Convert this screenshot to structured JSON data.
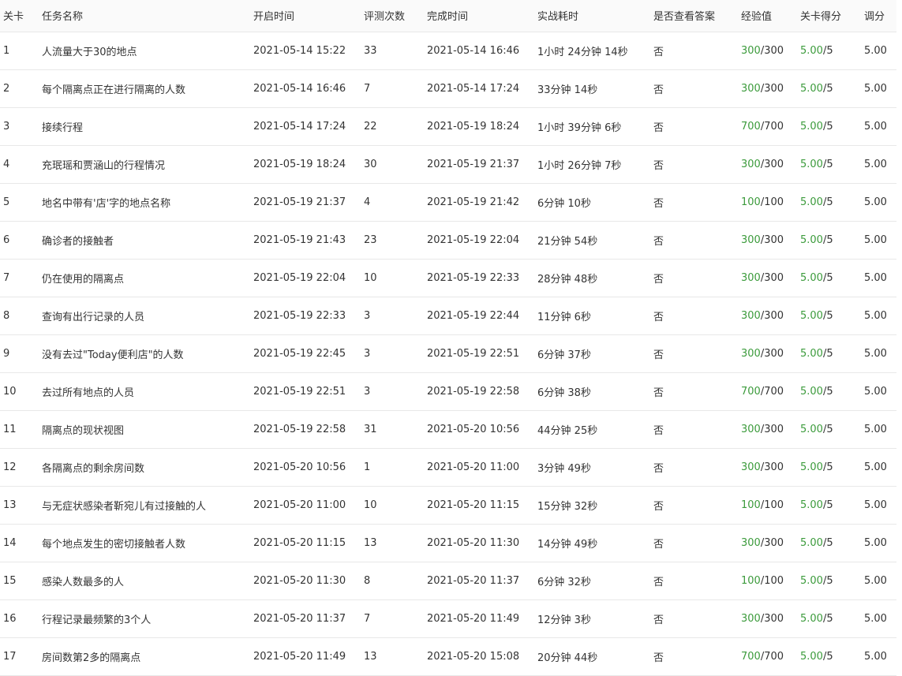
{
  "table": {
    "columns": [
      "关卡",
      "任务名称",
      "开启时间",
      "评测次数",
      "完成时间",
      "实战耗时",
      "是否查看答案",
      "经验值",
      "关卡得分",
      "调分"
    ],
    "rows": [
      {
        "level": "1",
        "name": "人流量大于30的地点",
        "start": "2021-05-14 15:22",
        "evals": "33",
        "finish": "2021-05-14 16:46",
        "duration": "1小时 24分钟 14秒",
        "answer_viewed": "否",
        "exp_value": "300",
        "exp_max": "/300",
        "score_value": "5.00",
        "score_max": "/5",
        "adjust": "5.00"
      },
      {
        "level": "2",
        "name": "每个隔离点正在进行隔离的人数",
        "start": "2021-05-14 16:46",
        "evals": "7",
        "finish": "2021-05-14 17:24",
        "duration": "33分钟 14秒",
        "answer_viewed": "否",
        "exp_value": "300",
        "exp_max": "/300",
        "score_value": "5.00",
        "score_max": "/5",
        "adjust": "5.00"
      },
      {
        "level": "3",
        "name": "接续行程",
        "start": "2021-05-14 17:24",
        "evals": "22",
        "finish": "2021-05-19 18:24",
        "duration": "1小时 39分钟 6秒",
        "answer_viewed": "否",
        "exp_value": "700",
        "exp_max": "/700",
        "score_value": "5.00",
        "score_max": "/5",
        "adjust": "5.00"
      },
      {
        "level": "4",
        "name": "充珉瑶和贾涵山的行程情况",
        "start": "2021-05-19 18:24",
        "evals": "30",
        "finish": "2021-05-19 21:37",
        "duration": "1小时 26分钟 7秒",
        "answer_viewed": "否",
        "exp_value": "300",
        "exp_max": "/300",
        "score_value": "5.00",
        "score_max": "/5",
        "adjust": "5.00"
      },
      {
        "level": "5",
        "name": "地名中带有'店'字的地点名称",
        "start": "2021-05-19 21:37",
        "evals": "4",
        "finish": "2021-05-19 21:42",
        "duration": "6分钟 10秒",
        "answer_viewed": "否",
        "exp_value": "100",
        "exp_max": "/100",
        "score_value": "5.00",
        "score_max": "/5",
        "adjust": "5.00"
      },
      {
        "level": "6",
        "name": "确诊者的接触者",
        "start": "2021-05-19 21:43",
        "evals": "23",
        "finish": "2021-05-19 22:04",
        "duration": "21分钟 54秒",
        "answer_viewed": "否",
        "exp_value": "300",
        "exp_max": "/300",
        "score_value": "5.00",
        "score_max": "/5",
        "adjust": "5.00"
      },
      {
        "level": "7",
        "name": "仍在使用的隔离点",
        "start": "2021-05-19 22:04",
        "evals": "10",
        "finish": "2021-05-19 22:33",
        "duration": "28分钟 48秒",
        "answer_viewed": "否",
        "exp_value": "300",
        "exp_max": "/300",
        "score_value": "5.00",
        "score_max": "/5",
        "adjust": "5.00"
      },
      {
        "level": "8",
        "name": "查询有出行记录的人员",
        "start": "2021-05-19 22:33",
        "evals": "3",
        "finish": "2021-05-19 22:44",
        "duration": "11分钟 6秒",
        "answer_viewed": "否",
        "exp_value": "300",
        "exp_max": "/300",
        "score_value": "5.00",
        "score_max": "/5",
        "adjust": "5.00"
      },
      {
        "level": "9",
        "name": "没有去过\"Today便利店\"的人数",
        "start": "2021-05-19 22:45",
        "evals": "3",
        "finish": "2021-05-19 22:51",
        "duration": "6分钟 37秒",
        "answer_viewed": "否",
        "exp_value": "300",
        "exp_max": "/300",
        "score_value": "5.00",
        "score_max": "/5",
        "adjust": "5.00"
      },
      {
        "level": "10",
        "name": "去过所有地点的人员",
        "start": "2021-05-19 22:51",
        "evals": "3",
        "finish": "2021-05-19 22:58",
        "duration": "6分钟 38秒",
        "answer_viewed": "否",
        "exp_value": "700",
        "exp_max": "/700",
        "score_value": "5.00",
        "score_max": "/5",
        "adjust": "5.00"
      },
      {
        "level": "11",
        "name": "隔离点的现状视图",
        "start": "2021-05-19 22:58",
        "evals": "31",
        "finish": "2021-05-20 10:56",
        "duration": "44分钟 25秒",
        "answer_viewed": "否",
        "exp_value": "300",
        "exp_max": "/300",
        "score_value": "5.00",
        "score_max": "/5",
        "adjust": "5.00"
      },
      {
        "level": "12",
        "name": "各隔离点的剩余房间数",
        "start": "2021-05-20 10:56",
        "evals": "1",
        "finish": "2021-05-20 11:00",
        "duration": "3分钟 49秒",
        "answer_viewed": "否",
        "exp_value": "300",
        "exp_max": "/300",
        "score_value": "5.00",
        "score_max": "/5",
        "adjust": "5.00"
      },
      {
        "level": "13",
        "name": "与无症状感染者靳宛儿有过接触的人",
        "start": "2021-05-20 11:00",
        "evals": "10",
        "finish": "2021-05-20 11:15",
        "duration": "15分钟 32秒",
        "answer_viewed": "否",
        "exp_value": "100",
        "exp_max": "/100",
        "score_value": "5.00",
        "score_max": "/5",
        "adjust": "5.00"
      },
      {
        "level": "14",
        "name": "每个地点发生的密切接触者人数",
        "start": "2021-05-20 11:15",
        "evals": "13",
        "finish": "2021-05-20 11:30",
        "duration": "14分钟 49秒",
        "answer_viewed": "否",
        "exp_value": "300",
        "exp_max": "/300",
        "score_value": "5.00",
        "score_max": "/5",
        "adjust": "5.00"
      },
      {
        "level": "15",
        "name": "感染人数最多的人",
        "start": "2021-05-20 11:30",
        "evals": "8",
        "finish": "2021-05-20 11:37",
        "duration": "6分钟 32秒",
        "answer_viewed": "否",
        "exp_value": "100",
        "exp_max": "/100",
        "score_value": "5.00",
        "score_max": "/5",
        "adjust": "5.00"
      },
      {
        "level": "16",
        "name": "行程记录最频繁的3个人",
        "start": "2021-05-20 11:37",
        "evals": "7",
        "finish": "2021-05-20 11:49",
        "duration": "12分钟 3秒",
        "answer_viewed": "否",
        "exp_value": "300",
        "exp_max": "/300",
        "score_value": "5.00",
        "score_max": "/5",
        "adjust": "5.00"
      },
      {
        "level": "17",
        "name": "房间数第2多的隔离点",
        "start": "2021-05-20 11:49",
        "evals": "13",
        "finish": "2021-05-20 15:08",
        "duration": "20分钟 44秒",
        "answer_viewed": "否",
        "exp_value": "700",
        "exp_max": "/700",
        "score_value": "5.00",
        "score_max": "/5",
        "adjust": "5.00"
      }
    ]
  },
  "colors": {
    "green": "#3c9b3c",
    "text": "#333333",
    "border": "#e8e8e8",
    "header_bg": "#fafafa"
  }
}
